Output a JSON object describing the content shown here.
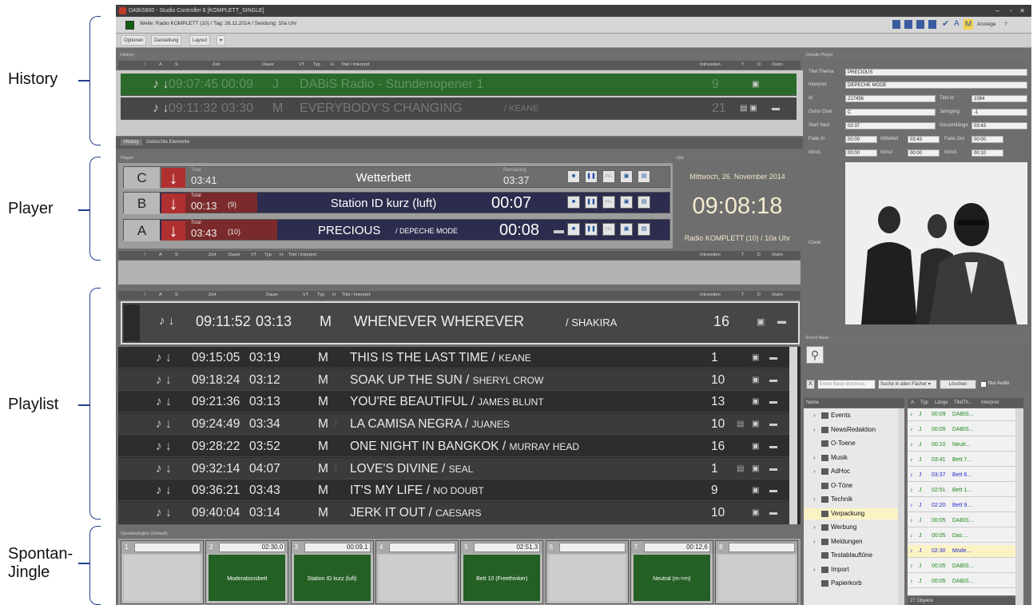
{
  "annotations": {
    "history": "History",
    "player": "Player",
    "playlist": "Playlist",
    "spontan_1": "Spontan-",
    "spontan_2": "Jingle"
  },
  "window": {
    "title": "DABiS800 - Studio Controller 8 [KOMPLETT_SINGLE]",
    "info": "Welle: Radio KOMPLETT (10) / Tag: 26.11.2014 / Sendung: 10a Uhr",
    "display_label": "Anzeige",
    "help_label": "?"
  },
  "menu": {
    "optionen": "Optionen",
    "darstellung": "Darstellung",
    "layout": "Layout"
  },
  "history": {
    "title": "History",
    "columns": {
      "bang": "!",
      "a": "A",
      "s": "S",
      "zeit": "Zeit",
      "dauer": "Dauer",
      "vt": "VT",
      "typ": "Typ",
      "h": "H",
      "titel": "Titel / Interpret",
      "intro": "Introzeiten",
      "t": "T",
      "d": "D",
      "outro": "Outro"
    },
    "rows": [
      {
        "time": "09:07:45",
        "dur": "00:09",
        "typ": "J",
        "title": "DABiS Radio - Stundenopener 1",
        "artist": "",
        "intro": "9"
      },
      {
        "time": "09:11:32",
        "dur": "03:30",
        "typ": "M",
        "title": "EVERYBODY'S CHANGING",
        "artist": "KEANE",
        "intro": "21"
      }
    ],
    "tabs": [
      "History",
      "Gelöschte Elemente"
    ]
  },
  "player": {
    "title": "Player",
    "decks": [
      {
        "label": "C",
        "total_label": "Total",
        "total": "03:41",
        "extra": "",
        "title": "Wetterbett",
        "remaining_label": "Remaining",
        "remaining": "03:37"
      },
      {
        "label": "B",
        "total_label": "Total",
        "total": "00:13",
        "extra": "(9)",
        "title": "Station ID kurz (luft)",
        "remaining_label": "",
        "remaining": "00:07"
      },
      {
        "label": "A",
        "total_label": "Total",
        "total": "03:43",
        "extra": "(10)",
        "title": "PRECIOUS",
        "artist": "DEPECHE MODE",
        "remaining_label": "",
        "remaining": "00:08"
      }
    ],
    "pfl": "PFL"
  },
  "clock": {
    "title": "Uhr",
    "date": "Mittwoch, 26. November 2014",
    "time": "09:08:18",
    "station": "Radio KOMPLETT (10) / 10a Uhr"
  },
  "playlist": {
    "current": {
      "time": "09:11:52",
      "dur": "03:13",
      "typ": "M",
      "title": "WHENEVER WHEREVER",
      "artist": "SHAKIRA",
      "intro": "16"
    },
    "rows": [
      {
        "time": "09:15:05",
        "dur": "03:19",
        "typ": "M",
        "h": "",
        "title": "THIS IS THE LAST TIME",
        "artist": "KEANE",
        "intro": "1"
      },
      {
        "time": "09:18:24",
        "dur": "03:12",
        "typ": "M",
        "h": "",
        "title": "SOAK UP THE SUN",
        "artist": "SHERYL CROW",
        "intro": "10"
      },
      {
        "time": "09:21:36",
        "dur": "03:13",
        "typ": "M",
        "h": "",
        "title": "YOU'RE BEAUTIFUL",
        "artist": "JAMES BLUNT",
        "intro": "13"
      },
      {
        "time": "09:24:49",
        "dur": "03:34",
        "typ": "M",
        "h": "J",
        "title": "LA CAMISA NEGRA",
        "artist": "JUANES",
        "intro": "10"
      },
      {
        "time": "09:28:22",
        "dur": "03:52",
        "typ": "M",
        "h": "",
        "title": "ONE NIGHT IN BANGKOK",
        "artist": "MURRAY HEAD",
        "intro": "16"
      },
      {
        "time": "09:32:14",
        "dur": "04:07",
        "typ": "M",
        "h": "J",
        "title": "LOVE'S DIVINE",
        "artist": "SEAL",
        "intro": "1"
      },
      {
        "time": "09:36:21",
        "dur": "03:43",
        "typ": "M",
        "h": "",
        "title": "IT'S MY LIFE",
        "artist": "NO DOUBT",
        "intro": "9"
      },
      {
        "time": "09:40:04",
        "dur": "03:14",
        "typ": "M",
        "h": "",
        "title": "JERK IT OUT",
        "artist": "CAESARS",
        "intro": "10"
      }
    ]
  },
  "jingles": {
    "title": "Spontanjingles (Default)",
    "slots": [
      {
        "n": "1",
        "time": "",
        "label": ""
      },
      {
        "n": "2",
        "time": "02:30,0",
        "label": "Moderationsbett"
      },
      {
        "n": "3",
        "time": "00:09,1",
        "label": "Station ID kurz (luft)"
      },
      {
        "n": "4",
        "time": "",
        "label": ""
      },
      {
        "n": "5",
        "time": "02:51,3",
        "label": "Bett 10 (Freethinker)"
      },
      {
        "n": "6",
        "time": "",
        "label": ""
      },
      {
        "n": "7",
        "time": "00:12,6",
        "label": "Neutral (m->m)"
      },
      {
        "n": "8",
        "time": "",
        "label": ""
      }
    ]
  },
  "details": {
    "title": "Details Player",
    "titel_thema_label": "Titel Thema",
    "titel_thema": "PRECIOUS",
    "interpret_label": "Interpret",
    "interpret": "DEPECHE MODE",
    "id_label": "Id",
    "id": "217456",
    "titel_id_label": "Titel Id",
    "titel_id": "1084",
    "outro_char_label": "Outro Char",
    "outro_char": "C",
    "jahrgang_label": "Jahrgang",
    "jahrgang": "-1",
    "start_next_label": "Start Next",
    "start_next": "03:37",
    "gesamt_label": "Gesamtlänge",
    "gesamt": "03:43",
    "fade_in_label": "Fade In",
    "fade_in": "00:00",
    "mittelteil_label": "Mitteltell",
    "mittelteil": "03:43",
    "fade_out_label": "Fade Out",
    "fade_out": "00:00",
    "intro1_label": "Intro1",
    "intro1": "00:00",
    "intro2_label": "Intro2",
    "intro2": "00:00",
    "intro3_label": "Intro3",
    "intro3": "00:10",
    "cover_label": "Cover"
  },
  "eventbase": {
    "title": "Event Base",
    "search_placeholder": "Event Base durchsuc",
    "scope": "Suche in allen Fächer",
    "delete_label": "Löschen",
    "audio_only": "Nur Audio",
    "tree_header": "Name",
    "tree": [
      "Events",
      "NewsRedaktion",
      "O-Toene",
      "Musik",
      "AdHoc",
      "O-Töne",
      "Technik",
      "Verpackung",
      "Werbung",
      "Meldungen",
      "Testablauftöne",
      "Import",
      "Papierkorb"
    ],
    "grid_headers": [
      "A",
      "Typ",
      "Länge",
      "TitelTh...",
      "Interpret"
    ],
    "grid": [
      {
        "len": "00:09",
        "name": "DABiS...",
        "color": "#1d8a1d"
      },
      {
        "len": "00:09",
        "name": "DABiS...",
        "color": "#1d8a1d"
      },
      {
        "len": "00:10",
        "name": "Neutr...",
        "color": "#1d8a1d"
      },
      {
        "len": "03:41",
        "name": "Bett 7...",
        "color": "#1d8a1d"
      },
      {
        "len": "03:37",
        "name": "Bett 8...",
        "color": "#2a2ad0"
      },
      {
        "len": "02:51",
        "name": "Bett 1...",
        "color": "#1d8a1d"
      },
      {
        "len": "02:20",
        "name": "Bett 9...",
        "color": "#2a2ad0"
      },
      {
        "len": "00:05",
        "name": "DABiS...",
        "color": "#1d8a1d"
      },
      {
        "len": "00:05",
        "name": "Das ...",
        "color": "#1d8a1d"
      },
      {
        "len": "02:30",
        "name": "Mode...",
        "color": "#2a2ad0"
      },
      {
        "len": "00:05",
        "name": "DABiS...",
        "color": "#1d8a1d"
      },
      {
        "len": "00:05",
        "name": "DABiS...",
        "color": "#1d8a1d"
      }
    ],
    "count": "27 Objekte"
  }
}
